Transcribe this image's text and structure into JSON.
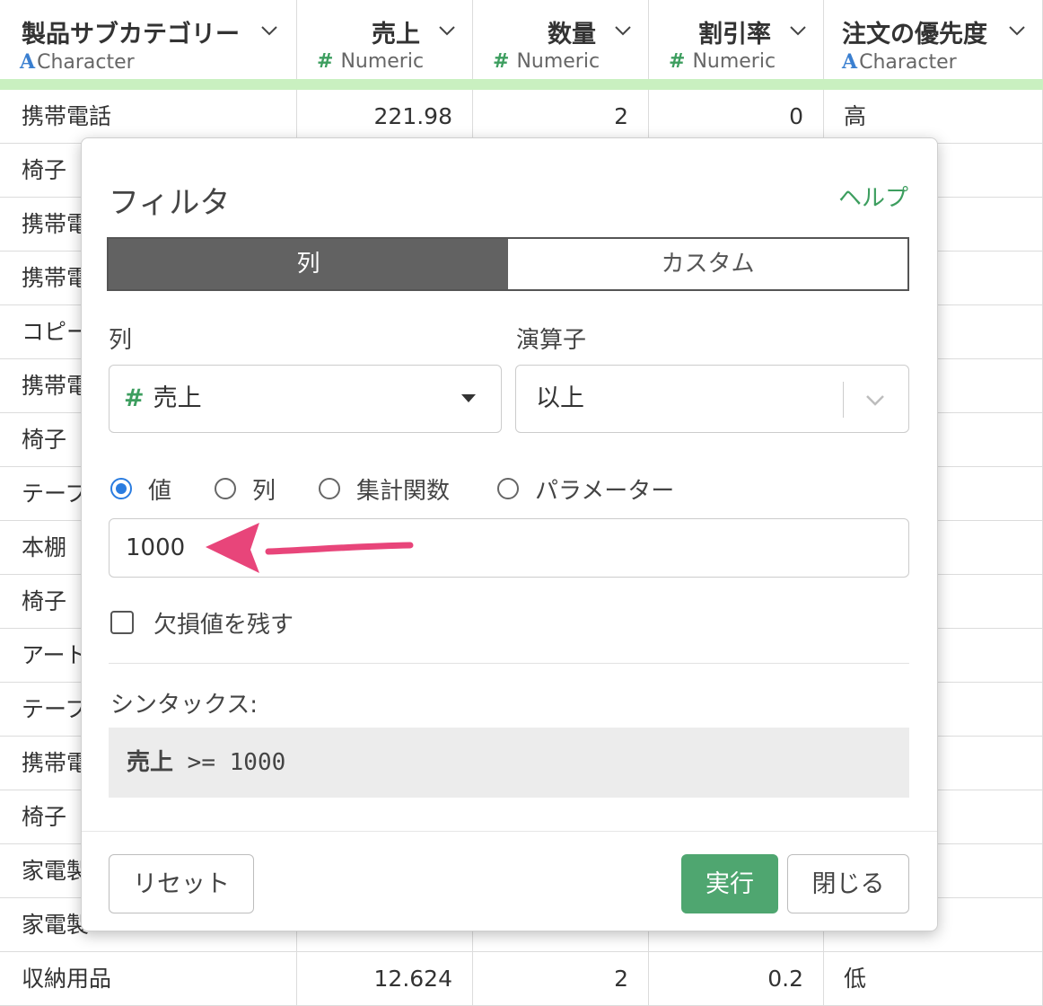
{
  "columns": [
    {
      "name": "製品サブカテゴリー",
      "type_glyph": "A",
      "type": "Character"
    },
    {
      "name": "売上",
      "type_glyph": "#",
      "type": "Numeric"
    },
    {
      "name": "数量",
      "type_glyph": "#",
      "type": "Numeric"
    },
    {
      "name": "割引率",
      "type_glyph": "#",
      "type": "Numeric"
    },
    {
      "name": "注文の優先度",
      "type_glyph": "A",
      "type": "Character"
    }
  ],
  "rows": [
    [
      "携帯電話",
      "221.98",
      "2",
      "0",
      "高"
    ],
    [
      "椅子",
      "",
      "",
      "",
      ""
    ],
    [
      "携帯電",
      "",
      "",
      "",
      ""
    ],
    [
      "携帯電",
      "",
      "",
      "",
      ""
    ],
    [
      "コピー",
      "",
      "",
      "",
      ""
    ],
    [
      "携帯電",
      "",
      "",
      "",
      ""
    ],
    [
      "椅子",
      "",
      "",
      "",
      ""
    ],
    [
      "テーブ",
      "",
      "",
      "",
      ""
    ],
    [
      "本棚",
      "",
      "",
      "",
      ""
    ],
    [
      "椅子",
      "",
      "",
      "",
      ""
    ],
    [
      "アート",
      "",
      "",
      "",
      ""
    ],
    [
      "テーブ",
      "",
      "",
      "",
      ""
    ],
    [
      "携帯電",
      "",
      "",
      "",
      ""
    ],
    [
      "椅子",
      "",
      "",
      "",
      ""
    ],
    [
      "家電製",
      "",
      "",
      "",
      ""
    ],
    [
      "家電製",
      "",
      "",
      "",
      ""
    ],
    [
      "収納用品",
      "12.624",
      "2",
      "0.2",
      "低"
    ]
  ],
  "colors": {
    "accent_green": "#4fa670",
    "type_char_blue": "#3a7fd0",
    "type_num_green": "#3d9e5f",
    "header_bar": "#c9f0c0",
    "arrow": "#e8457a"
  },
  "filter": {
    "title": "フィルタ",
    "help": "ヘルプ",
    "tabs": {
      "column": "列",
      "custom": "カスタム"
    },
    "column_label": "列",
    "column_glyph": "#",
    "column_value": "売上",
    "operator_label": "演算子",
    "operator_value": "以上",
    "radios": {
      "value": "値",
      "column": "列",
      "aggregate": "集計関数",
      "parameter": "パラメーター"
    },
    "input_value": "1000",
    "keep_na": "欠損値を残す",
    "syntax_label": "シンタックス:",
    "syntax_col": "売上",
    "syntax_expr": ">= 1000",
    "buttons": {
      "reset": "リセット",
      "run": "実行",
      "close": "閉じる"
    }
  }
}
